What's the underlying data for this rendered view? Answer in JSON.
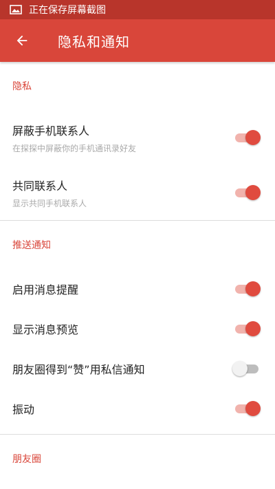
{
  "status_bar": {
    "text": "正在保存屏幕截图",
    "icon": "image-icon"
  },
  "app_bar": {
    "title": "隐私和通知",
    "back_icon": "arrow-left-icon"
  },
  "sections": [
    {
      "header": "隐私",
      "items": [
        {
          "primary": "屏蔽手机联系人",
          "secondary": "在探探中屏蔽你的手机通讯录好友",
          "enabled": true
        },
        {
          "primary": "共同联系人",
          "secondary": "显示共同手机联系人",
          "enabled": true
        }
      ]
    },
    {
      "header": "推送通知",
      "items": [
        {
          "primary": "启用消息提醒",
          "enabled": true
        },
        {
          "primary": "显示消息预览",
          "enabled": true
        },
        {
          "primary": "朋友圈得到“赞”用私信通知",
          "enabled": false
        },
        {
          "primary": "振动",
          "enabled": true
        }
      ]
    },
    {
      "header": "朋友圈"
    }
  ],
  "colors": {
    "accent": "#d9463a",
    "status_bar": "#b8352b"
  }
}
